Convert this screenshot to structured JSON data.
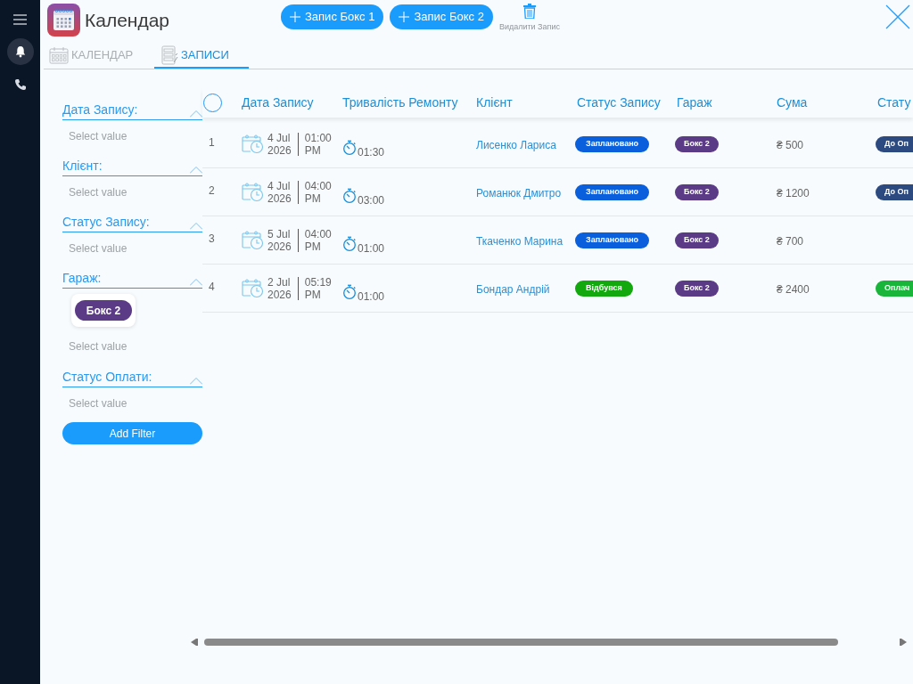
{
  "sidebar": {
    "nav_items": [
      {
        "selected": true
      },
      {
        "selected": false
      }
    ]
  },
  "header": {
    "title": "Календар",
    "add_buttons": [
      {
        "label": "Запис Бокс 1"
      },
      {
        "label": "Запис Бокс 2"
      }
    ],
    "delete_button": {
      "label": "Видалити Запис"
    }
  },
  "tabs": [
    {
      "label": "КАЛЕНДАР",
      "selected": false
    },
    {
      "label": "ЗАПИСИ",
      "selected": true
    }
  ],
  "filters": [
    {
      "label": "Дата Запису:",
      "expanded": true,
      "placeholder": "Select value"
    },
    {
      "label": "Клієнт:",
      "expanded": true,
      "placeholder": "Select value"
    },
    {
      "label": "Статус Запису:",
      "expanded": true,
      "placeholder": "Select value"
    },
    {
      "label": "Гараж:",
      "expanded": true,
      "chips": [
        {
          "label": "Бокс 2"
        }
      ],
      "placeholder": "Select value"
    },
    {
      "label": "Статус Оплати:",
      "expanded": true,
      "placeholder": "Select value"
    }
  ],
  "add_filter_button": {
    "label": "Add Filter"
  },
  "table": {
    "select_all": {
      "checked": false
    },
    "columns": [
      "Дата Запису",
      "Тривалість Ремонту",
      "Клієнт",
      "Статус Запису",
      "Гараж",
      "Сума",
      "Стату"
    ],
    "rows": [
      {
        "number": "1",
        "date": "4 Jul",
        "year": "2026",
        "time": "01:00",
        "period": "PM",
        "duration": "01:30",
        "client": "Лисенко Лариса",
        "status": {
          "label": "Заплановано",
          "color": "#0a5fdc"
        },
        "garage": "Бокс 2",
        "amount": "₴ 500",
        "payment": {
          "label": "До Оп",
          "color": "#2c4a80"
        }
      },
      {
        "number": "2",
        "date": "4 Jul",
        "year": "2026",
        "time": "04:00",
        "period": "PM",
        "duration": "03:00",
        "client": "Романюк Дмитро",
        "status": {
          "label": "Заплановано",
          "color": "#0a5fdc"
        },
        "garage": "Бокс 2",
        "amount": "₴ 1200",
        "payment": {
          "label": "До Оп",
          "color": "#2c4a80"
        }
      },
      {
        "number": "3",
        "date": "5 Jul",
        "year": "2026",
        "time": "04:00",
        "period": "PM",
        "duration": "01:00",
        "client": "Ткаченко Марина",
        "status": {
          "label": "Заплановано",
          "color": "#0a5fdc"
        },
        "garage": "Бокс 2",
        "amount": "₴ 700"
      },
      {
        "number": "4",
        "date": "2 Jul",
        "year": "2026",
        "time": "05:19",
        "period": "PM",
        "duration": "01:00",
        "client": "Бондар Андрій",
        "status": {
          "label": "Відбувся",
          "color": "#12a80e"
        },
        "garage": "Бокс 2",
        "amount": "₴ 2400",
        "payment": {
          "label": "Оплач",
          "color": "#19b53b"
        }
      }
    ]
  }
}
